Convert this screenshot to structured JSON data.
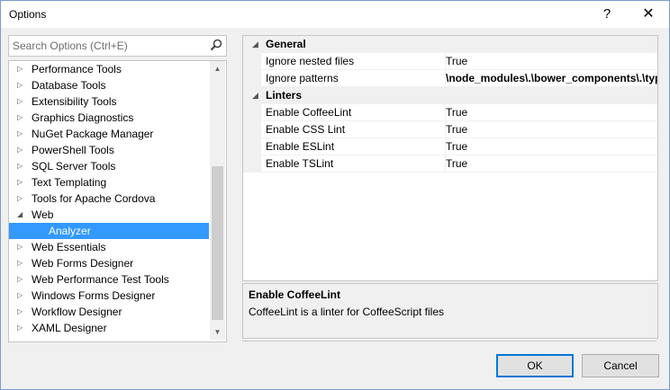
{
  "window": {
    "title": "Options",
    "help_label": "?",
    "close_label": "✕"
  },
  "search": {
    "placeholder": "Search Options (Ctrl+E)"
  },
  "tree": [
    {
      "label": "Performance Tools",
      "expander": "▷"
    },
    {
      "label": "Database Tools",
      "expander": "▷"
    },
    {
      "label": "Extensibility Tools",
      "expander": "▷"
    },
    {
      "label": "Graphics Diagnostics",
      "expander": "▷"
    },
    {
      "label": "NuGet Package Manager",
      "expander": "▷"
    },
    {
      "label": "PowerShell Tools",
      "expander": "▷"
    },
    {
      "label": "SQL Server Tools",
      "expander": "▷"
    },
    {
      "label": "Text Templating",
      "expander": "▷"
    },
    {
      "label": "Tools for Apache Cordova",
      "expander": "▷"
    },
    {
      "label": "Web",
      "expander": "◢"
    },
    {
      "label": "Analyzer",
      "expander": ""
    },
    {
      "label": "Web Essentials",
      "expander": "▷"
    },
    {
      "label": "Web Forms Designer",
      "expander": "▷"
    },
    {
      "label": "Web Performance Test Tools",
      "expander": "▷"
    },
    {
      "label": "Windows Forms Designer",
      "expander": "▷"
    },
    {
      "label": "Workflow Designer",
      "expander": "▷"
    },
    {
      "label": "XAML Designer",
      "expander": "▷"
    }
  ],
  "scrollbar": {
    "up": "▲",
    "down": "▼"
  },
  "grid": {
    "expander": "◢",
    "categories": [
      {
        "name": "General",
        "properties": [
          {
            "name": "Ignore nested files",
            "value": "True"
          },
          {
            "name": "Ignore patterns",
            "value": "\\node_modules\\.\\bower_components\\.\\typ"
          }
        ]
      },
      {
        "name": "Linters",
        "properties": [
          {
            "name": "Enable CoffeeLint",
            "value": "True"
          },
          {
            "name": "Enable CSS Lint",
            "value": "True"
          },
          {
            "name": "Enable ESLint",
            "value": "True"
          },
          {
            "name": "Enable TSLint",
            "value": "True"
          }
        ]
      }
    ]
  },
  "description": {
    "title": "Enable CoffeeLint",
    "text": "CoffeeLint is a linter for CoffeeScript files"
  },
  "buttons": {
    "ok": "OK",
    "cancel": "Cancel"
  },
  "colors": {
    "selection": "#3399ff",
    "ok_border": "#0078d7"
  }
}
